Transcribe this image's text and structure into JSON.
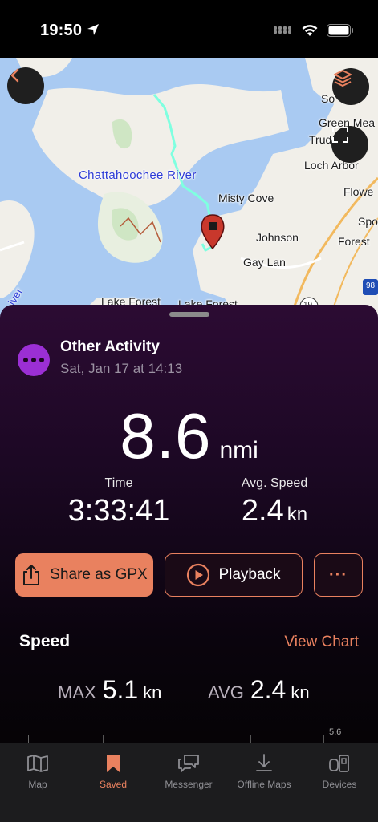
{
  "status_bar": {
    "time": "19:50"
  },
  "map": {
    "labels": {
      "river": "Chattahoochee River",
      "misty_cove": "Misty Cove",
      "johnson": "Johnson",
      "gay_lan": "Gay Lan",
      "green_mea": "Green Mea",
      "trud": "Trud",
      "loch_arbor": "Loch Arbor",
      "flowe": "Flowe",
      "spo": "Spo",
      "forest": "Forest",
      "so": "So",
      "lake_forest_1": "Lake Forest",
      "lake_forest_2": "Lake Forest",
      "iver": "iver",
      "highway": "19",
      "interstate": "98"
    }
  },
  "activity": {
    "type": "Other Activity",
    "date": "Sat, Jan 17 at 14:13",
    "distance": "8.6",
    "distance_unit": "nmi",
    "time_label": "Time",
    "time_value": "3:33:41",
    "avg_speed_label": "Avg. Speed",
    "avg_speed_value": "2.4",
    "avg_speed_unit": "kn"
  },
  "actions": {
    "share": "Share as GPX",
    "playback": "Playback",
    "more": "···"
  },
  "speed": {
    "title": "Speed",
    "view_chart": "View Chart",
    "max_label": "MAX",
    "max_value": "5.1",
    "max_unit": "kn",
    "avg_label": "AVG",
    "avg_value": "2.4",
    "avg_unit": "kn",
    "chart_top_tick": "5.6"
  },
  "tabs": [
    {
      "label": "Map",
      "icon": "map-icon"
    },
    {
      "label": "Saved",
      "icon": "bookmark-icon"
    },
    {
      "label": "Messenger",
      "icon": "chat-icon"
    },
    {
      "label": "Offline Maps",
      "icon": "download-icon"
    },
    {
      "label": "Devices",
      "icon": "devices-icon"
    }
  ],
  "colors": {
    "accent": "#e9815f",
    "activity": "#9b2fd4",
    "track": "#7fffe0"
  }
}
